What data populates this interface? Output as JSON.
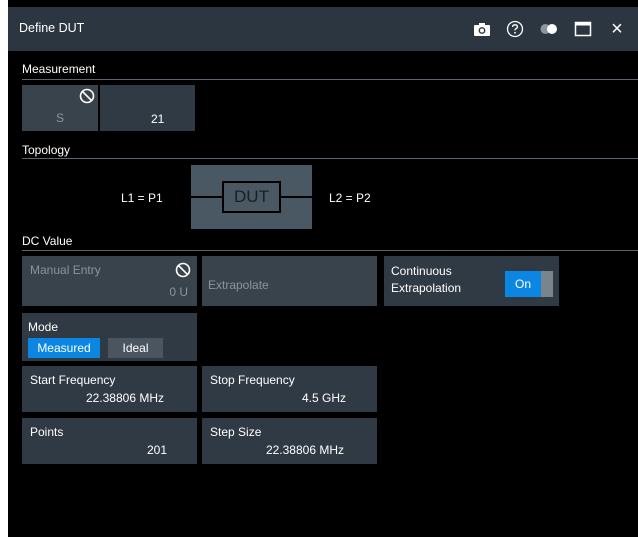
{
  "dialog": {
    "title": "Define DUT"
  },
  "titlebar_icons": [
    "camera-icon",
    "help-icon",
    "contrast-toggle-icon",
    "maximize-icon",
    "close-icon"
  ],
  "close_glyph": "×",
  "measurement": {
    "section_label": "Measurement",
    "param_label": "S",
    "param_value": "21"
  },
  "topology": {
    "section_label": "Topology",
    "left_port": "L1 = P1",
    "dut_label": "DUT",
    "right_port": "L2 = P2"
  },
  "dc_value": {
    "section_label": "DC Value",
    "manual_entry": {
      "label": "Manual Entry",
      "value": "0 U"
    },
    "extrapolate_label": "Extrapolate",
    "continuous_extrapolation": {
      "label_line1": "Continuous",
      "label_line2": "Extrapolation",
      "state": "On"
    }
  },
  "mode": {
    "label": "Mode",
    "options": [
      "Measured",
      "Ideal"
    ],
    "selected": "Measured"
  },
  "fields": {
    "start_frequency": {
      "label": "Start Frequency",
      "value": "22.38806 MHz"
    },
    "stop_frequency": {
      "label": "Stop Frequency",
      "value": "4.5 GHz"
    },
    "points": {
      "label": "Points",
      "value": "201"
    },
    "step_size": {
      "label": "Step Size",
      "value": "22.38806 MHz"
    }
  },
  "colors": {
    "titlebar": "#2b3640",
    "tile": "#303a44",
    "accent": "#0b86e3",
    "dut_block": "#4a5863"
  }
}
